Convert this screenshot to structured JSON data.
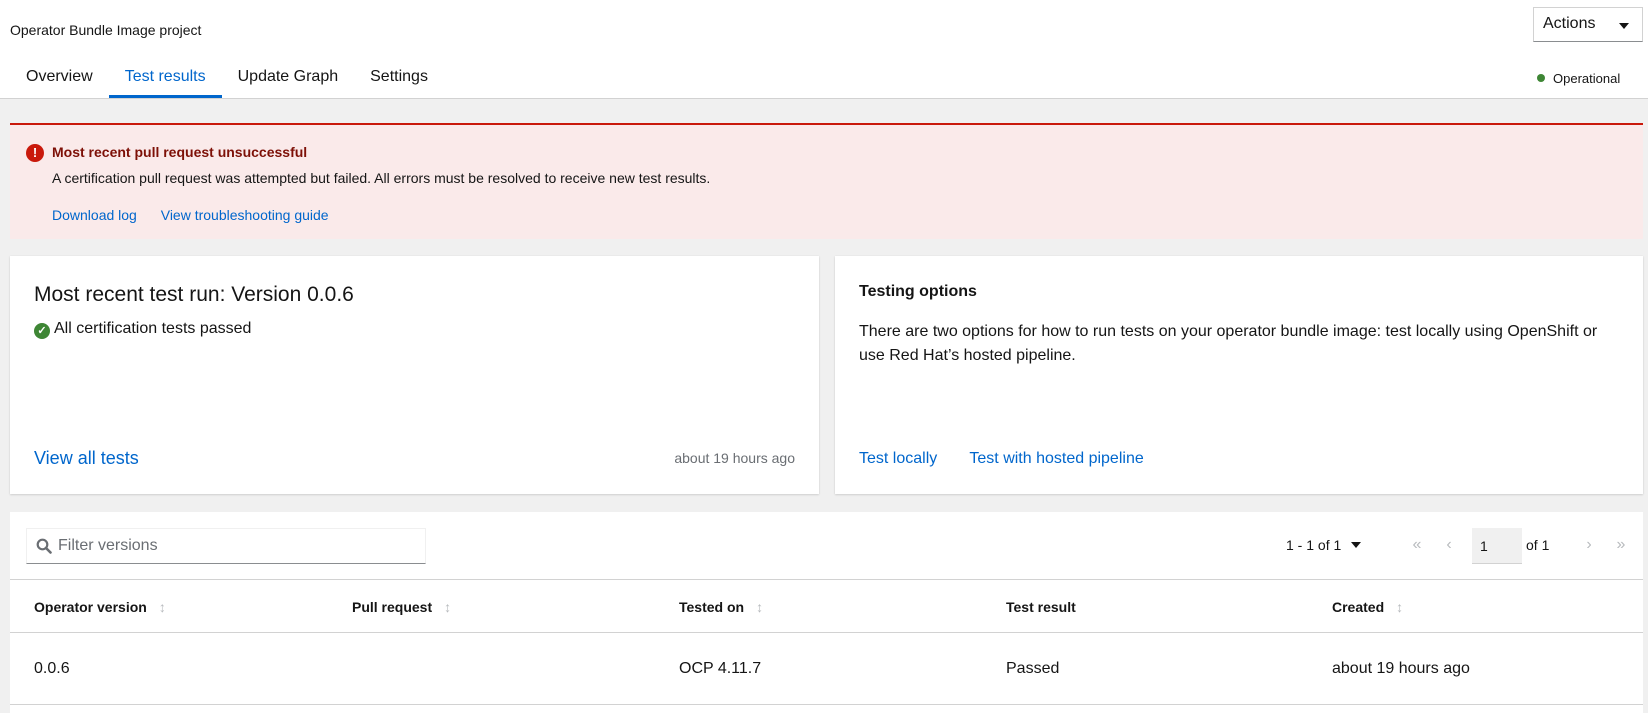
{
  "header": {
    "subtitle": "Operator Bundle Image project",
    "actions_label": "Actions",
    "tabs": [
      {
        "label": "Overview"
      },
      {
        "label": "Test results"
      },
      {
        "label": "Update Graph"
      },
      {
        "label": "Settings"
      }
    ],
    "active_tab": "Test results",
    "status": "Operational"
  },
  "alert": {
    "title": "Most recent pull request unsuccessful",
    "description": "A certification pull request was attempted but failed. All errors must be resolved to receive new test results.",
    "links": [
      "Download log",
      "View troubleshooting guide"
    ]
  },
  "recent_run": {
    "title": "Most recent test run: Version 0.0.6",
    "status": "All certification tests passed",
    "view_all": "View all tests",
    "time_ago": "about 19 hours ago"
  },
  "testing_options": {
    "title": "Testing options",
    "description": "There are two options for how to run tests on your operator bundle image: test locally using OpenShift or use Red Hat’s hosted pipeline.",
    "links": [
      "Test locally",
      "Test with hosted pipeline"
    ]
  },
  "table": {
    "filter_placeholder": "Filter versions",
    "pagination": {
      "range": "1 - 1 of 1",
      "page": "1",
      "of_pages": "of 1"
    },
    "columns": [
      "Operator version",
      "Pull request",
      "Tested on",
      "Test result",
      "Created"
    ],
    "rows": [
      {
        "version": "0.0.6",
        "pull_request": "",
        "tested_on": "OCP 4.11.7",
        "result": "Passed",
        "created": "about 19 hours ago"
      }
    ]
  },
  "colors": {
    "link": "#0066cc",
    "danger": "#c9190b",
    "success": "#3e8635"
  }
}
